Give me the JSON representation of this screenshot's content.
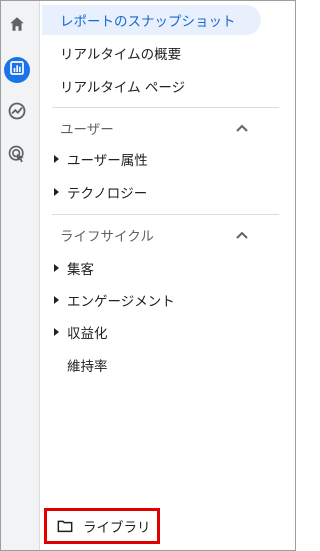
{
  "rail": {
    "icons": [
      "home-icon",
      "reports-icon",
      "explore-icon",
      "advertising-icon"
    ]
  },
  "nav": {
    "items": [
      {
        "label": "レポートのスナップショット",
        "active": true
      },
      {
        "label": "リアルタイムの概要",
        "active": false
      },
      {
        "label": "リアルタイム ページ",
        "active": false
      }
    ]
  },
  "sections": [
    {
      "title": "ユーザー",
      "expanded": true,
      "items": [
        {
          "label": "ユーザー属性",
          "expandable": true
        },
        {
          "label": "テクノロジー",
          "expandable": true
        }
      ]
    },
    {
      "title": "ライフサイクル",
      "expanded": true,
      "items": [
        {
          "label": "集客",
          "expandable": true
        },
        {
          "label": "エンゲージメント",
          "expandable": true
        },
        {
          "label": "収益化",
          "expandable": true
        },
        {
          "label": "維持率",
          "expandable": false
        }
      ]
    }
  ],
  "library": {
    "label": "ライブラリ",
    "icon": "folder-icon",
    "highlight_color": "#e00000"
  },
  "colors": {
    "accent": "#1a73e8",
    "active_bg": "#e8f0fe",
    "active_text": "#1967d2"
  }
}
